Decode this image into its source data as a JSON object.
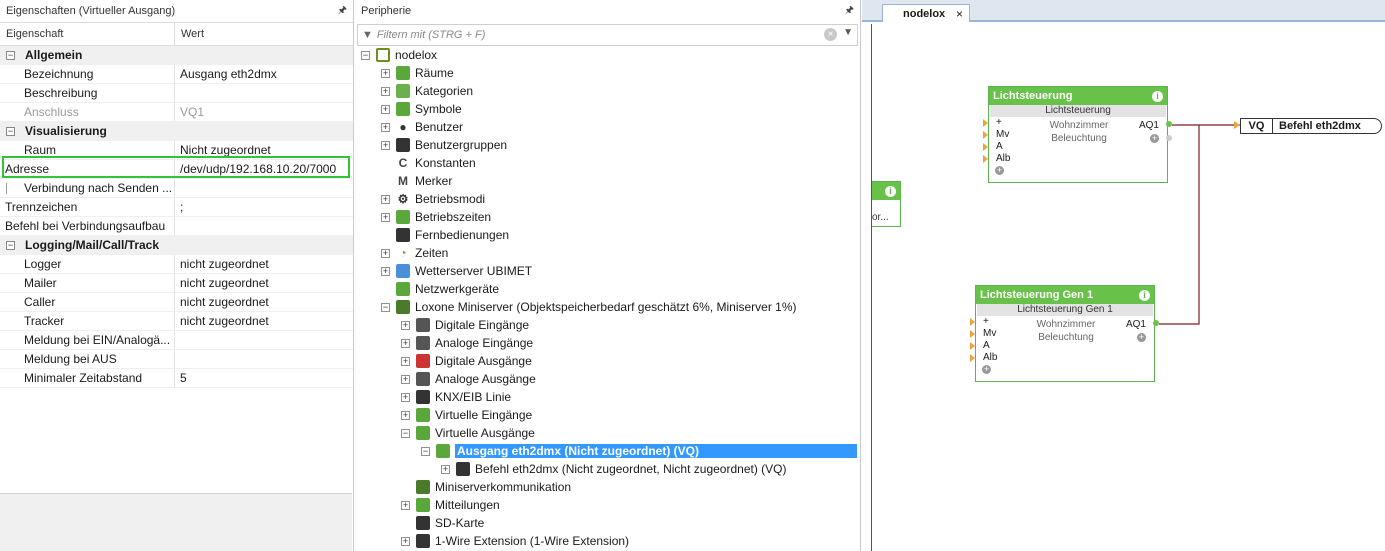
{
  "props": {
    "title": "Eigenschaften (Virtueller Ausgang)",
    "col_key": "Eigenschaft",
    "col_value": "Wert",
    "rows": [
      {
        "key": "Allgemein",
        "value": "",
        "cat": true
      },
      {
        "key": "Bezeichnung",
        "value": "Ausgang eth2dmx"
      },
      {
        "key": "Beschreibung",
        "value": ""
      },
      {
        "key": "Anschluss",
        "value": "VQ1",
        "grey": true
      },
      {
        "key": "Visualisierung",
        "value": "",
        "cat": true
      },
      {
        "key": "Raum",
        "value": "Nicht zugeordnet"
      },
      {
        "key": "Adresse",
        "value": "/dev/udp/192.168.10.20/7000",
        "top": true
      },
      {
        "key": "Verbindung nach Senden ...",
        "value": "",
        "check": true
      },
      {
        "key": "Trennzeichen",
        "value": ";",
        "top": true
      },
      {
        "key": "Befehl bei Verbindungsaufbau",
        "value": "",
        "top": true
      },
      {
        "key": "Logging/Mail/Call/Track",
        "value": "",
        "cat": true
      },
      {
        "key": "Logger",
        "value": "nicht zugeordnet"
      },
      {
        "key": "Mailer",
        "value": "nicht zugeordnet"
      },
      {
        "key": "Caller",
        "value": "nicht zugeordnet"
      },
      {
        "key": "Tracker",
        "value": "nicht zugeordnet"
      },
      {
        "key": "Meldung bei EIN/Analogä...",
        "value": ""
      },
      {
        "key": "Meldung bei AUS",
        "value": ""
      },
      {
        "key": "Minimaler Zeitabstand",
        "value": "5"
      }
    ]
  },
  "tree": {
    "title": "Peripherie",
    "filter_placeholder": "Filtern mit (STRG + F)",
    "nodes": [
      {
        "label": "nodelox",
        "icon": "controller-icon",
        "state": "-"
      },
      {
        "label": "Räume",
        "icon": "rooms-icon",
        "state": "+"
      },
      {
        "label": "Kategorien",
        "icon": "categories-icon",
        "state": "+"
      },
      {
        "label": "Symbole",
        "icon": "image-icon",
        "state": "+"
      },
      {
        "label": "Benutzer",
        "icon": "user-icon",
        "state": "+"
      },
      {
        "label": "Benutzergruppen",
        "icon": "users-icon",
        "state": "+"
      },
      {
        "label": "Konstanten",
        "icon": "constant-icon",
        "state": ""
      },
      {
        "label": "Merker",
        "icon": "marker-icon",
        "state": ""
      },
      {
        "label": "Betriebsmodi",
        "icon": "gear-icon",
        "state": "+"
      },
      {
        "label": "Betriebszeiten",
        "icon": "calendar-icon",
        "state": "+"
      },
      {
        "label": "Fernbedienungen",
        "icon": "remote-icon",
        "state": ""
      },
      {
        "label": "Zeiten",
        "icon": "clock-icon",
        "state": "+"
      },
      {
        "label": "Wetterserver UBIMET",
        "icon": "weather-icon",
        "state": "+"
      },
      {
        "label": "Netzwerkgeräte",
        "icon": "network-icon",
        "state": ""
      },
      {
        "label": "Loxone Miniserver (Objektspeicherbedarf geschätzt 6%, Miniserver 1%)",
        "icon": "miniserver-icon",
        "state": "-"
      },
      {
        "label": "Digitale Eingänge",
        "icon": "digital-in-icon",
        "state": "+"
      },
      {
        "label": "Analoge Eingänge",
        "icon": "analog-in-icon",
        "state": "+"
      },
      {
        "label": "Digitale Ausgänge",
        "icon": "digital-out-icon",
        "state": "+"
      },
      {
        "label": "Analoge Ausgänge",
        "icon": "analog-out-icon",
        "state": "+"
      },
      {
        "label": "KNX/EIB Linie",
        "icon": "knx-icon",
        "state": "+"
      },
      {
        "label": "Virtuelle Eingänge",
        "icon": "virtual-in-icon",
        "state": "+"
      },
      {
        "label": "Virtuelle Ausgänge",
        "icon": "virtual-out-icon",
        "state": "-"
      },
      {
        "label": "Ausgang eth2dmx (Nicht zugeordnet) (VQ)",
        "icon": "virtual-out-icon",
        "state": "-",
        "selected": true
      },
      {
        "label": "Befehl eth2dmx (Nicht zugeordnet, Nicht zugeordnet) (VQ)",
        "icon": "command-icon",
        "state": "+"
      },
      {
        "label": "Miniserverkommunikation",
        "icon": "miniserver-icon",
        "state": ""
      },
      {
        "label": "Mitteilungen",
        "icon": "messages-icon",
        "state": "+"
      },
      {
        "label": "SD-Karte",
        "icon": "sdcard-icon",
        "state": ""
      },
      {
        "label": "1-Wire Extension (1-Wire Extension)",
        "icon": "extension-icon",
        "state": "+"
      }
    ]
  },
  "canvas": {
    "tab_label": "nodelox",
    "tab_close": "×",
    "block1": {
      "title": "Lichtsteuerung",
      "sub": "Lichtsteuerung",
      "room": "Wohnzimmer",
      "cat": "Beleuchtung",
      "out": "AQ1"
    },
    "block2": {
      "title": "Lichtsteuerung Gen 1",
      "sub": "Lichtsteuerung Gen 1",
      "room": "Wohnzimmer",
      "cat": "Beleuchtung",
      "out": "AQ1"
    },
    "inputs": [
      "+",
      "Mv",
      "A",
      "Alb"
    ],
    "partial_label": "or...",
    "vq_tag": "VQ",
    "vq_label": "Befehl eth2dmx"
  },
  "colors": {
    "selection": "#3399ff",
    "block_header": "#68c24a",
    "highlight_border": "#34c334",
    "wire": "#7a1f1f"
  }
}
